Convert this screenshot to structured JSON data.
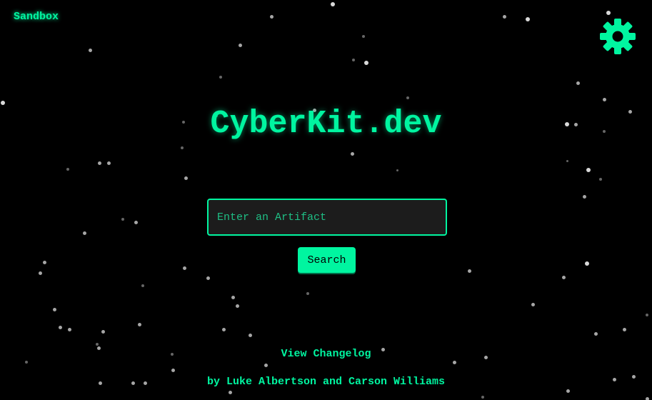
{
  "nav": {
    "sandbox_label": "Sandbox"
  },
  "header": {
    "title": "CyberKit.dev"
  },
  "search": {
    "placeholder": "Enter an Artifact",
    "value": "",
    "button_label": "Search"
  },
  "footer": {
    "changelog_label": "View Changelog",
    "credits": "by Luke Albertson and Carson Williams"
  },
  "icons": {
    "settings": "gear-icon"
  },
  "theme": {
    "accent": "#00f5a0",
    "background": "#000000",
    "input_background": "#1c1c1c",
    "star": "#ffffff"
  }
}
